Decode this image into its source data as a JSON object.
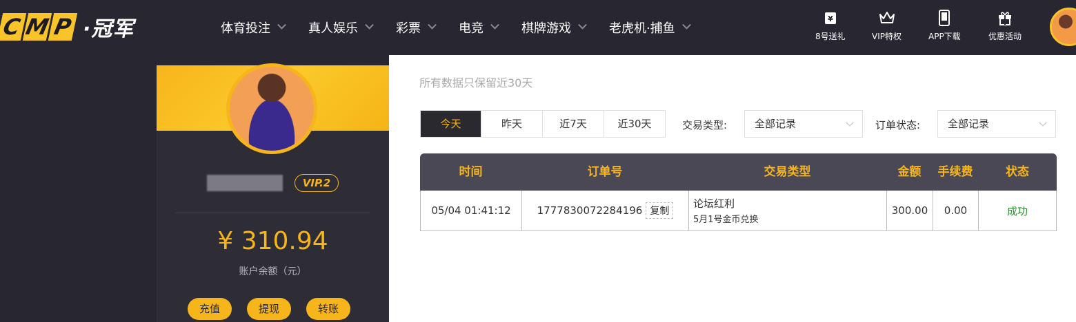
{
  "header": {
    "logo_letters": [
      "C",
      "M",
      "P"
    ],
    "logo_text": "·冠军",
    "nav": [
      "体育投注",
      "真人娱乐",
      "彩票",
      "电竞",
      "棋牌游戏",
      "老虎机·捕鱼"
    ],
    "quick": [
      {
        "label": "8号送礼",
        "icon": "yen-gift-icon"
      },
      {
        "label": "VIP特权",
        "icon": "crown-icon"
      },
      {
        "label": "APP下载",
        "icon": "phone-icon"
      },
      {
        "label": "优惠活动",
        "icon": "gift-icon"
      }
    ]
  },
  "profile": {
    "vip": "VIP.2",
    "balance": "¥ 310.94",
    "balance_label": "账户余额（元）",
    "buttons": [
      "充值",
      "提现",
      "转账"
    ]
  },
  "main": {
    "notice": "所有数据只保留近30天",
    "tabs": [
      "今天",
      "昨天",
      "近7天",
      "近30天"
    ],
    "filters": {
      "type_label": "交易类型:",
      "type_value": "全部记录",
      "status_label": "订单状态:",
      "status_value": "全部记录"
    },
    "table": {
      "headers": [
        "时间",
        "订单号",
        "交易类型",
        "金额",
        "手续费",
        "状态"
      ],
      "rows": [
        {
          "time": "05/04 01:41:12",
          "order_no": "1777830072284196",
          "copy_label": "复制",
          "type": "论坛红利",
          "type_sub": "5月1号金币兑换",
          "amount": "300.00",
          "fee": "0.00",
          "status": "成功"
        }
      ]
    }
  },
  "colors": {
    "accent": "#f7b51c",
    "dark": "#282630",
    "success": "#2e8b2e"
  }
}
